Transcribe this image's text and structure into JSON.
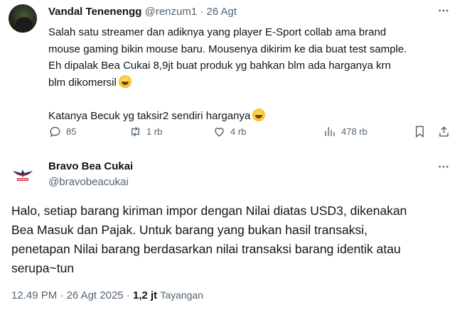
{
  "tweet1": {
    "name": "Vandal Tenenengg",
    "handle": "@renzum1",
    "separator": "·",
    "date": "26 Agt",
    "body_lines": [
      "Salah satu streamer dan adiknya yang player E-Sport collab ama brand",
      "mouse gaming bikin mouse baru. Mousenya dikirim ke dia buat test sample.",
      "Eh dipalak Bea Cukai 8,9jt buat produk yg bahkan blm ada harganya krn",
      "blm dikomersil"
    ],
    "body_line2": "Katanya Becuk yg taksir2 sendiri harganya",
    "emoji_icon": "rolling-on-floor-laughing-emoji",
    "actions": {
      "replies": "85",
      "reposts": "1 rb",
      "likes": "4 rb",
      "views": "478 rb"
    }
  },
  "tweet2": {
    "name": "Bravo Bea Cukai",
    "handle": "@bravobeacukai",
    "body_lines": [
      "Halo, setiap barang kiriman impor dengan Nilai diatas USD3, dikenakan",
      "Bea Masuk dan Pajak. Untuk barang yang bukan hasil transaksi,",
      "penetapan Nilai barang berdasarkan nilai transaksi barang identik atau",
      "serupa~tun"
    ],
    "meta": {
      "time": "12.49 PM",
      "separator": "·",
      "date": "26 Agt 2025",
      "separator2": "·",
      "views": "1,2 jt",
      "views_label": "Tayangan"
    }
  },
  "colors": {
    "text": "#0f1419",
    "muted": "#536471",
    "logo_red": "#d7262b",
    "logo_navy": "#1d2b6b"
  }
}
